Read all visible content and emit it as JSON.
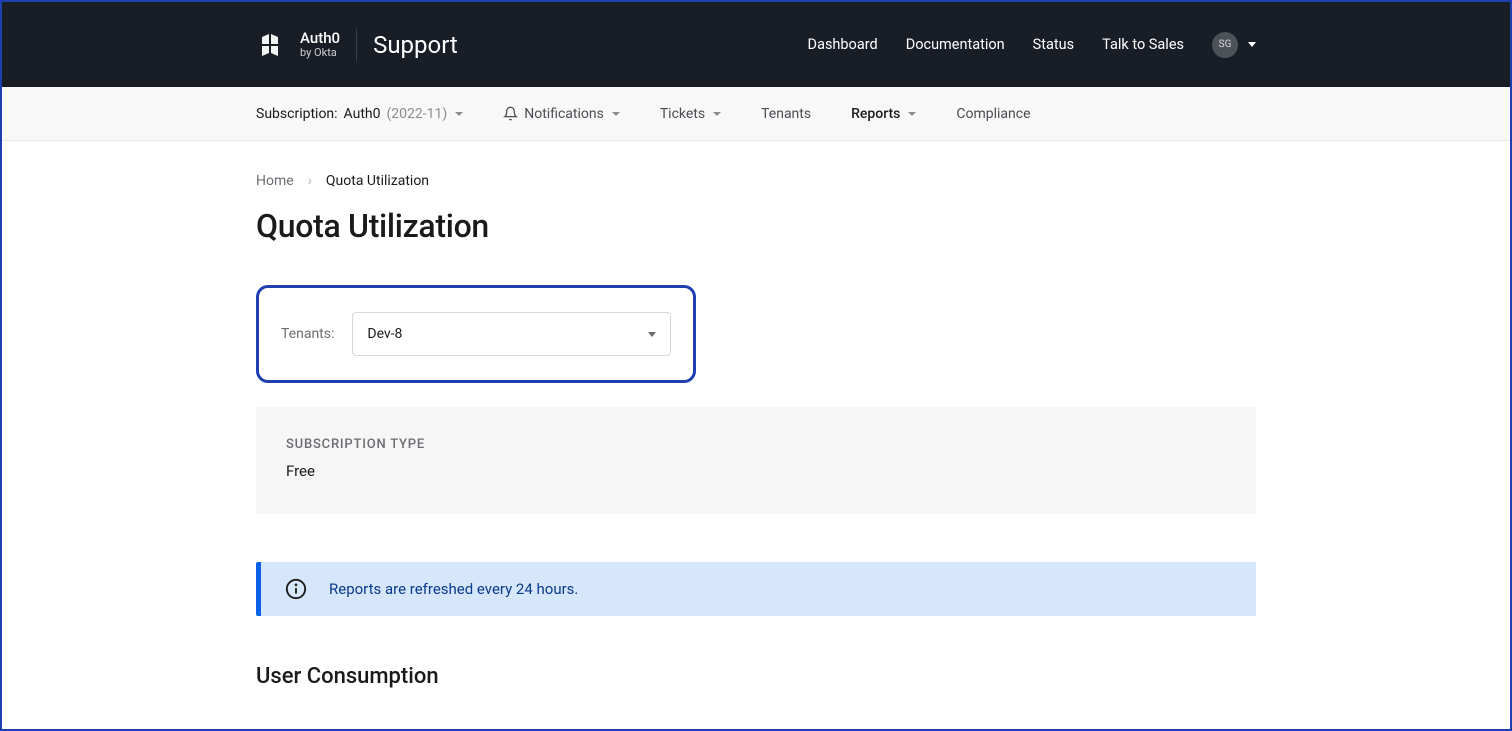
{
  "header": {
    "logo_top": "Auth0",
    "logo_bottom": "by Okta",
    "support_label": "Support",
    "nav": [
      "Dashboard",
      "Documentation",
      "Status",
      "Talk to Sales"
    ],
    "avatar_initials": "SG"
  },
  "subheader": {
    "subscription_prefix": "Subscription:",
    "subscription_name": "Auth0",
    "subscription_paren": "(2022-11)",
    "items": [
      "Notifications",
      "Tickets",
      "Tenants",
      "Reports",
      "Compliance"
    ],
    "active_index": 3
  },
  "breadcrumb": {
    "home": "Home",
    "current": "Quota Utilization"
  },
  "page_title": "Quota Utilization",
  "tenant_selector": {
    "label": "Tenants:",
    "selected": "Dev-8"
  },
  "subscription_card": {
    "label": "SUBSCRIPTION TYPE",
    "value": "Free"
  },
  "info_banner": {
    "text": "Reports are refreshed every 24 hours."
  },
  "section_title": "User Consumption"
}
